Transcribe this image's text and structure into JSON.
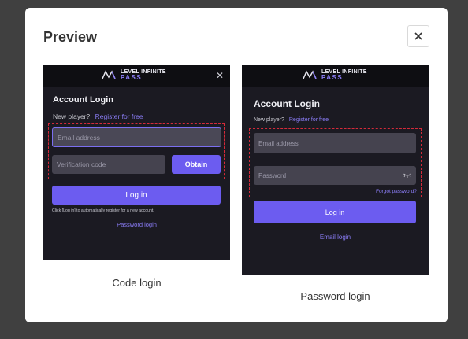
{
  "modal": {
    "title": "Preview"
  },
  "brand": {
    "line1": "LEVEL INFINITE",
    "line2": "PASS"
  },
  "code_card": {
    "title": "Account Login",
    "new_player": "New player?",
    "register": "Register for free",
    "email_placeholder": "Email address",
    "code_placeholder": "Verification code",
    "obtain": "Obtain",
    "login": "Log in",
    "hint": "Click [Log in] to automatically register for a new account.",
    "switch_link": "Password login",
    "caption": "Code login"
  },
  "password_card": {
    "title": "Account Login",
    "new_player": "New player?",
    "register": "Register for free",
    "email_placeholder": "Email address",
    "password_placeholder": "Password",
    "forgot": "Forgot password?",
    "login": "Log in",
    "switch_link": "Email login",
    "caption": "Password login"
  },
  "colors": {
    "accent": "#6c5cf0",
    "highlight": "#d42a3a",
    "card_bg": "#1b1a22"
  },
  "icons": [
    "close-icon",
    "level-infinite-logo",
    "eye-closed-icon"
  ]
}
